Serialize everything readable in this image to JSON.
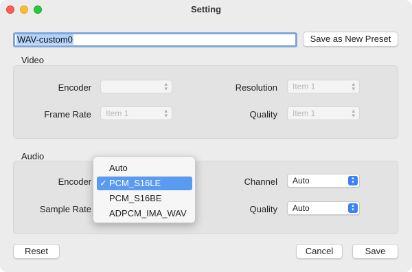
{
  "window": {
    "title": "Setting"
  },
  "preset": {
    "name_value": "WAV-custom0",
    "save_new_label": "Save as New Preset"
  },
  "video": {
    "section_label": "Video",
    "encoder_label": "Encoder",
    "encoder_value": "",
    "resolution_label": "Resolution",
    "resolution_value": "Item 1",
    "frame_rate_label": "Frame Rate",
    "frame_rate_value": "Item 1",
    "quality_label": "Quality",
    "quality_value": "Item 1"
  },
  "audio": {
    "section_label": "Audio",
    "encoder_label": "Encoder",
    "sample_rate_label": "Sample Rate",
    "channel_label": "Channel",
    "channel_value": "Auto",
    "quality_label": "Quality",
    "quality_value": "Auto",
    "encoder_menu": {
      "items": [
        "Auto",
        "PCM_S16LE",
        "PCM_S16BE",
        "ADPCM_IMA_WAV"
      ],
      "selected_index": 1,
      "check_mark": "✓"
    }
  },
  "footer": {
    "reset_label": "Reset",
    "cancel_label": "Cancel",
    "save_label": "Save"
  },
  "colors": {
    "accent": "#3b82f6",
    "menu_highlight": "#5a9af0",
    "selection": "#b3d2f7"
  }
}
